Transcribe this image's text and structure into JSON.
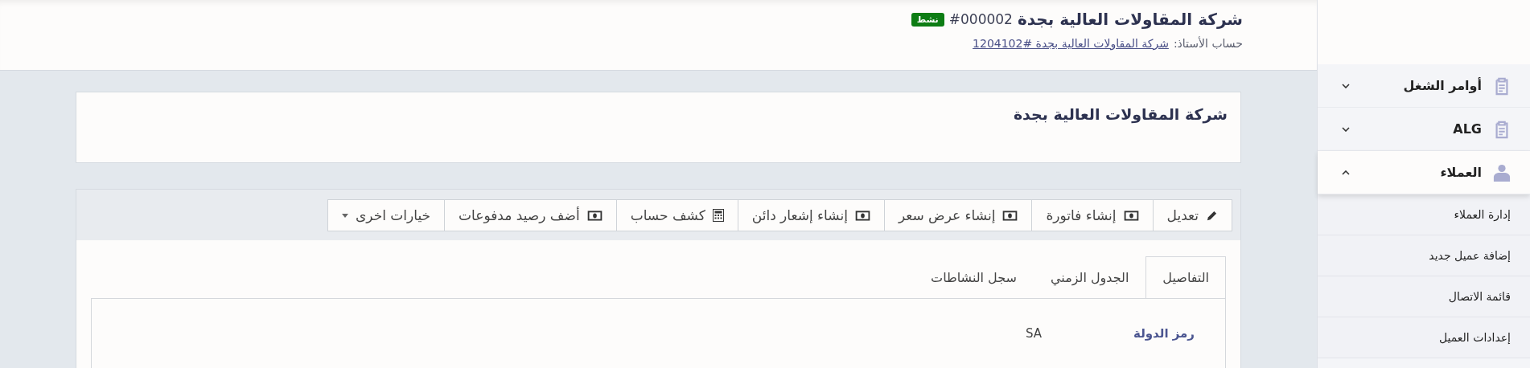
{
  "header": {
    "title": "شركة المقاولات العالية بجدة",
    "number": "#000002",
    "status_badge": "نشط",
    "ledger_label": "حساب الأستاذ:",
    "ledger_link": "شركة المقاولات العالية بجدة #1204102"
  },
  "summary_card": {
    "title": "شركة المقاولات العالية بجدة"
  },
  "toolbar": [
    {
      "label": "تعديل",
      "kind": "edit"
    },
    {
      "label": "إنشاء فاتورة",
      "kind": "money"
    },
    {
      "label": "إنشاء عرض سعر",
      "kind": "money"
    },
    {
      "label": "إنشاء إشعار دائن",
      "kind": "money"
    },
    {
      "label": "كشف حساب",
      "kind": "statement"
    },
    {
      "label": "أضف رصيد مدفوعات",
      "kind": "money"
    },
    {
      "label": "خيارات اخرى",
      "kind": "dropdown"
    }
  ],
  "tabs": [
    {
      "label": "التفاصيل",
      "selected": true
    },
    {
      "label": "الجدول الزمني",
      "selected": false
    },
    {
      "label": "سجل النشاطات",
      "selected": false
    }
  ],
  "details": [
    {
      "label": "رمز الدولة",
      "value": "SA"
    }
  ],
  "sidebar": {
    "items": [
      {
        "label": "أوامر الشغل",
        "kind": "clipboard",
        "expanded": false
      },
      {
        "label": "ALG",
        "kind": "clipboard",
        "expanded": false
      },
      {
        "label": "العملاء",
        "kind": "person",
        "expanded": true,
        "children": [
          {
            "label": "إدارة العملاء"
          },
          {
            "label": "إضافة عميل جديد"
          },
          {
            "label": "قائمة الاتصال"
          },
          {
            "label": "إعدادات العميل"
          }
        ]
      }
    ]
  }
}
